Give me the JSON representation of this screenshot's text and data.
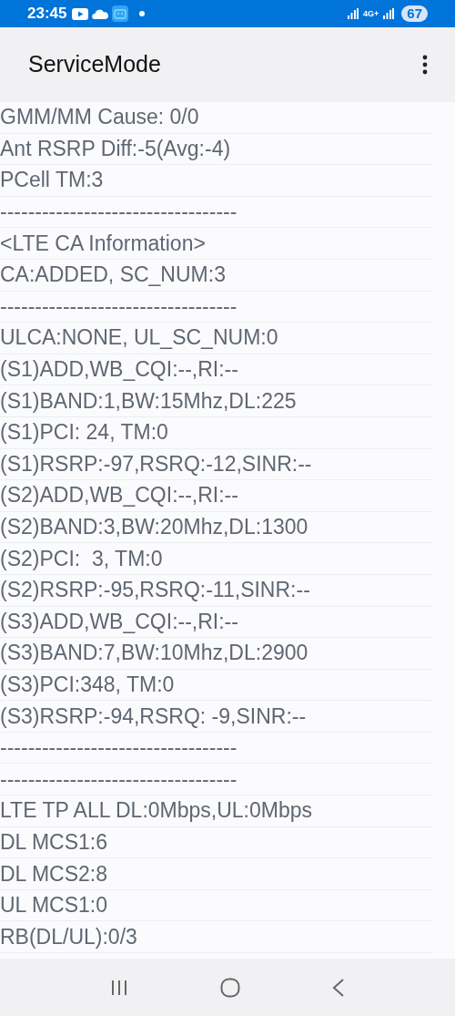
{
  "status_bar": {
    "time": "23:45",
    "network": "4G+",
    "battery": "67"
  },
  "app_bar": {
    "title": "ServiceMode"
  },
  "lines": [
    "GMM/MM Cause: 0/0",
    "Ant RSRP Diff:-5(Avg:-4)",
    "PCell TM:3",
    "----------------------------------",
    "<LTE CA Information>",
    "CA:ADDED, SC_NUM:3",
    "----------------------------------",
    "ULCA:NONE, UL_SC_NUM:0",
    "(S1)ADD,WB_CQI:--,RI:--",
    "(S1)BAND:1,BW:15Mhz,DL:225",
    "(S1)PCI: 24, TM:0",
    "(S1)RSRP:-97,RSRQ:-12,SINR:--",
    "(S2)ADD,WB_CQI:--,RI:--",
    "(S2)BAND:3,BW:20Mhz,DL:1300",
    "(S2)PCI:  3, TM:0",
    "(S2)RSRP:-95,RSRQ:-11,SINR:--",
    "(S3)ADD,WB_CQI:--,RI:--",
    "(S3)BAND:7,BW:10Mhz,DL:2900",
    "(S3)PCI:348, TM:0",
    "(S3)RSRP:-94,RSRQ: -9,SINR:--",
    "----------------------------------",
    "----------------------------------",
    "LTE TP ALL DL:0Mbps,UL:0Mbps",
    "DL MCS1:6",
    "DL MCS2:8",
    "UL MCS1:0",
    "RB(DL/UL):0/3"
  ]
}
